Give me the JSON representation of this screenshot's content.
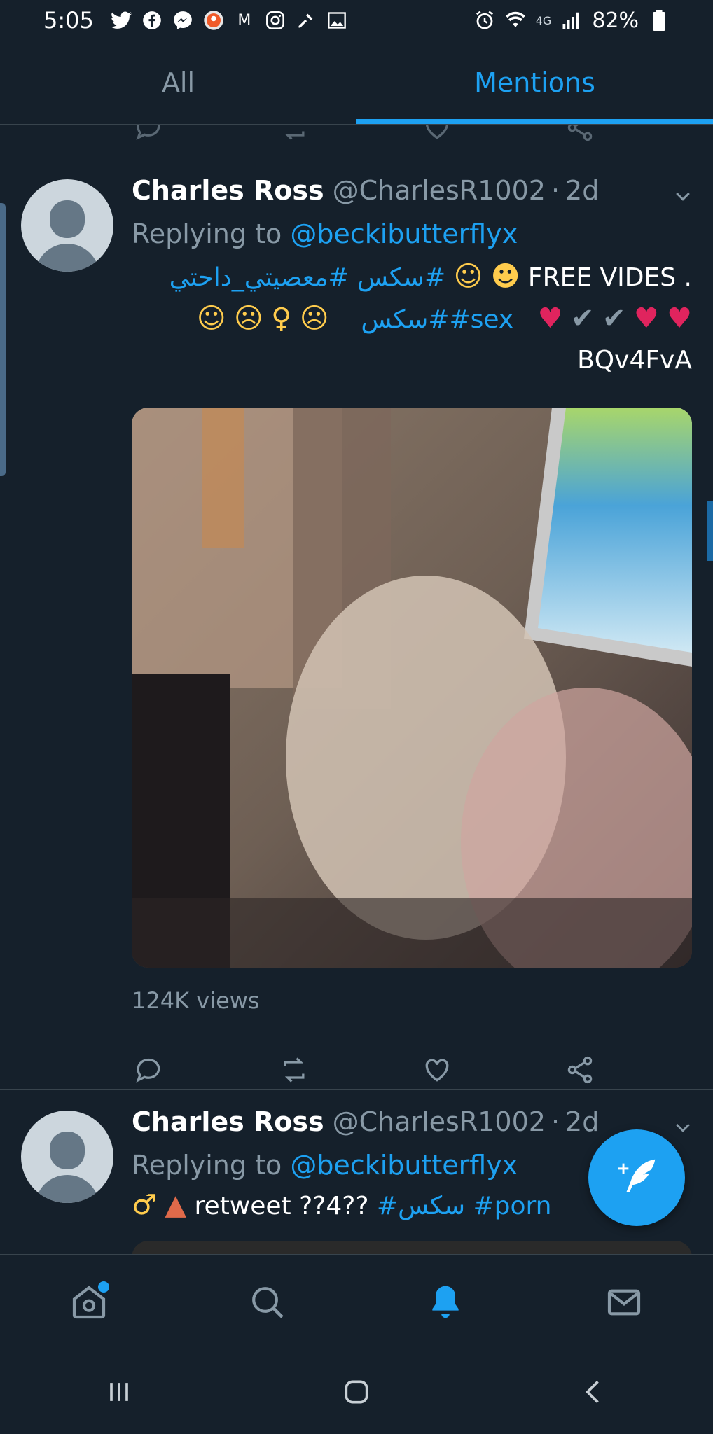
{
  "status_bar": {
    "time": "5:05",
    "network": "4G",
    "battery": "82%"
  },
  "tabs": [
    {
      "label": "All",
      "active": false
    },
    {
      "label": "Mentions",
      "active": true
    }
  ],
  "tweets": [
    {
      "name": "Charles Ross",
      "handle": "@CharlesR1002",
      "dot": "·",
      "time": "2d",
      "replying_prefix": "Replying to ",
      "replying_to": "@beckibutterflyx",
      "text_line1_hashtags": "سكس #معصيتي_داحتي",
      "text_line1_hash_prefix": "#",
      "text_line1_plain": "FREE VIDES .",
      "text_line2_hashtags": "سكس##sex",
      "text_line3": "BQv4FvA",
      "views": "124K views"
    },
    {
      "name": "Charles Ross",
      "handle": "@CharlesR1002",
      "dot": "·",
      "time": "2d",
      "replying_prefix": "Replying to ",
      "replying_to": "@beckibutterflyx",
      "text_plain": "retweet ??4??",
      "hashtag1": "#سكس",
      "hashtag2": "#porn"
    }
  ],
  "colors": {
    "background": "#15202b",
    "accent": "#1da1f2",
    "muted": "#8899a6",
    "divider": "#38444d",
    "heart": "#e0245e"
  },
  "nav": {
    "items": [
      "home-icon",
      "search-icon",
      "bell-icon",
      "mail-icon"
    ],
    "active": "bell-icon"
  }
}
